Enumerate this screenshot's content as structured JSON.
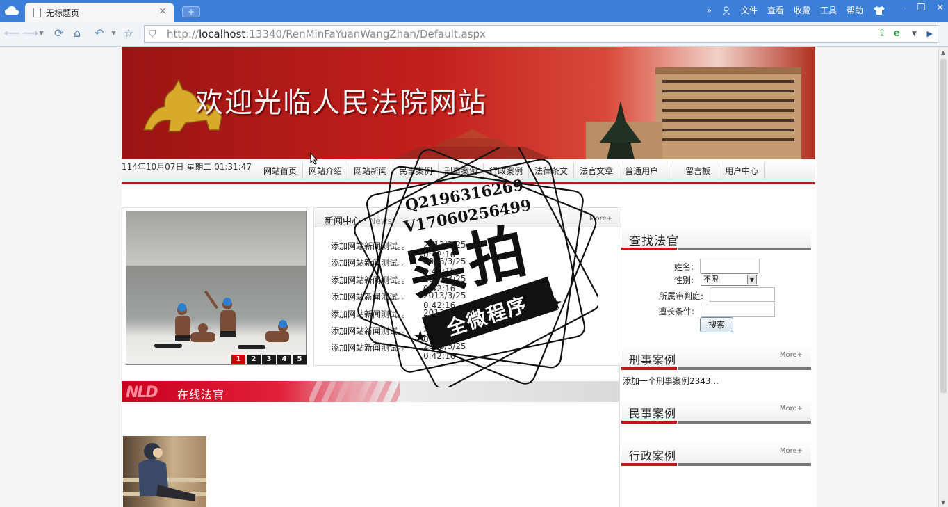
{
  "browser": {
    "tab_title": "无标题页",
    "tab_close": "×",
    "new_tab": "+",
    "menus": [
      "»",
      "文件",
      "查看",
      "收藏",
      "工具",
      "帮助"
    ],
    "window_controls": [
      "–",
      "❐",
      "✕"
    ],
    "url_host": "http://localhost",
    "url_bold": "localhost",
    "url_prefix": "http://",
    "url_rest": ":13340/RenMinFaYuanWangZhan/Default.aspx"
  },
  "banner": {
    "title": "欢迎光临人民法院网站"
  },
  "menubar": {
    "datetime": "114年10月07日 星期二 01:31:47",
    "links": [
      "网站首页",
      "网站介绍",
      "网站新闻",
      "民事案例",
      "刑事案例",
      "行政案例",
      "法律条文",
      "法官文章",
      "普通用户",
      "留言板",
      "用户中心"
    ]
  },
  "slider": {
    "pages": [
      "1",
      "2",
      "3",
      "4",
      "5"
    ],
    "active_page": "1"
  },
  "news": {
    "title": "新闻中心",
    "sep": "·",
    "title_en": "News",
    "more": "More+",
    "items": [
      {
        "title": "添加网站新闻测试。。",
        "date": "2013/3/25 0:42:16"
      },
      {
        "title": "添加网站新闻测试。。",
        "date": "2013/3/25 0:42:16"
      },
      {
        "title": "添加网站新闻测试。。",
        "date": "2013/3/25 0:42:16"
      },
      {
        "title": "添加网站新闻测试。。",
        "date": "2013/3/25 0:42:16"
      },
      {
        "title": "添加网站新闻测试。。",
        "date": "2013/3/25 0:42:16"
      },
      {
        "title": "添加网站新闻测试。。",
        "date": "2013/3/25 0:42:16"
      },
      {
        "title": "添加网站新闻测试。。",
        "date": "2013/3/25 0:42:16"
      }
    ]
  },
  "find_judge": {
    "title": "查找法官",
    "name_label": "姓名:",
    "gender_label": "性别:",
    "gender_value": "不限",
    "court_label": "所属审判庭:",
    "skill_label": "擅长条件:",
    "search_button": "搜索"
  },
  "criminal": {
    "title": "刑事案例",
    "more": "More+",
    "item": "添加一个刑事案例2343..."
  },
  "civil": {
    "title": "民事案例",
    "more": "More+"
  },
  "admin": {
    "title": "行政案例",
    "more": "More+"
  },
  "online": {
    "logo": "NLD",
    "title": "在线法官"
  },
  "watermark": {
    "qq": "Q2196316269",
    "vx": "V17060256499",
    "big": "实拍",
    "ribbon": "全微程序"
  },
  "colors": {
    "chrome_blue": "#3c7fd8",
    "banner_red": "#c3201c",
    "menu_underline": "#b31a1a"
  }
}
